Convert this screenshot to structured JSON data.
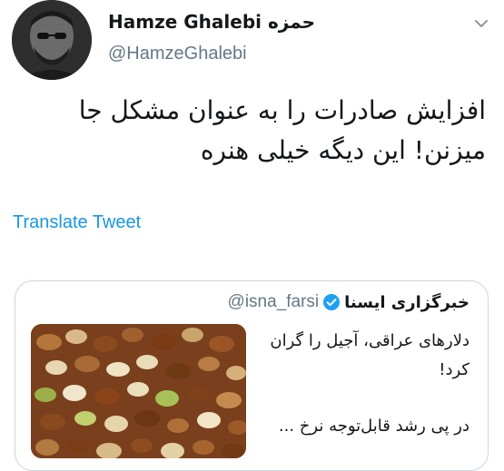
{
  "tweet": {
    "author": {
      "display_name": "Hamze Ghalebi حمزه",
      "handle": "@HamzeGhalebi"
    },
    "text_lines": [
      "افزایش صادرات را به عنوان مشکل جا",
      "میزنن! این دیگه خیلی هنره"
    ],
    "translate_label": "Translate Tweet",
    "menu_icon": "chevron-down-icon"
  },
  "quoted_tweet": {
    "display_name": "خبرگزاری ایسنا",
    "handle": "@isna_farsi",
    "verified_icon": "verified-badge-icon",
    "text_lines": [
      "دلارهای عراقی، آجیل را گران",
      "کرد!"
    ],
    "text_tail": "در پی رشد قابل‌توجه نرخ ..."
  },
  "colors": {
    "link": "#1b95e0",
    "secondary_text": "#657786",
    "border": "#ccd6dd",
    "verified": "#1da1f2"
  }
}
